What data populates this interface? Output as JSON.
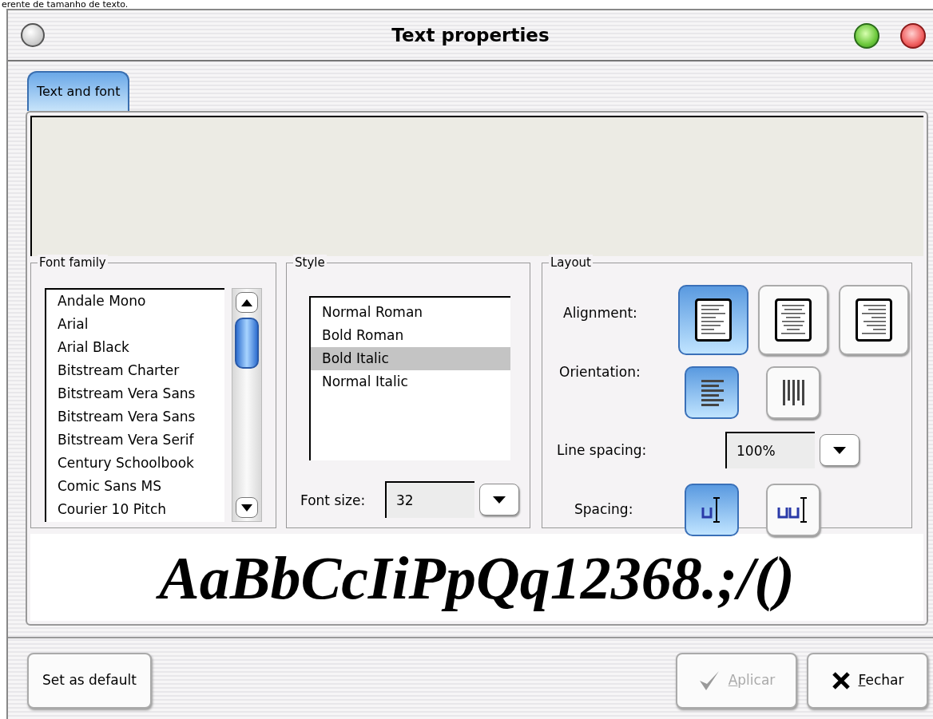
{
  "caption": "erente de tamanho de texto.",
  "window": {
    "title": "Text properties"
  },
  "tabs": [
    {
      "label": "Text and font",
      "selected": true
    }
  ],
  "font_family": {
    "label": "Font family",
    "items": [
      {
        "label": "Andale Mono",
        "selected": false
      },
      {
        "label": "Arial",
        "selected": false
      },
      {
        "label": "Arial Black",
        "selected": false
      },
      {
        "label": "Bitstream Charter",
        "selected": false
      },
      {
        "label": "Bitstream Vera Sans",
        "selected": false
      },
      {
        "label": "Bitstream Vera Sans",
        "selected": false
      },
      {
        "label": "Bitstream Vera Serif",
        "selected": false
      },
      {
        "label": "Century Schoolbook",
        "selected": false
      },
      {
        "label": "Comic Sans MS",
        "selected": false
      },
      {
        "label": "Courier 10 Pitch",
        "selected": false
      }
    ]
  },
  "style": {
    "label": "Style",
    "items": [
      {
        "label": "Normal Roman",
        "selected": false
      },
      {
        "label": "Bold Roman",
        "selected": false
      },
      {
        "label": "Bold Italic",
        "selected": true
      },
      {
        "label": "Normal Italic",
        "selected": false
      }
    ],
    "font_size": {
      "label": "Font size:",
      "value": "32"
    }
  },
  "layout": {
    "label": "Layout",
    "alignment": {
      "label": "Alignment:",
      "options": [
        {
          "kind": "left",
          "selected": true
        },
        {
          "kind": "center",
          "selected": false
        },
        {
          "kind": "right",
          "selected": false
        }
      ]
    },
    "orientation": {
      "label": "Orientation:",
      "options": [
        {
          "kind": "horizontal",
          "selected": true
        },
        {
          "kind": "vertical",
          "selected": false
        }
      ]
    },
    "line_spacing": {
      "label": "Line spacing:",
      "value": "100%"
    },
    "spacing": {
      "label": "Spacing:",
      "options": [
        {
          "kind": "narrow",
          "selected": true
        },
        {
          "kind": "wide",
          "selected": false
        }
      ]
    }
  },
  "sample": {
    "text": "AaBbCcIiPpQq12368.;/()"
  },
  "buttons": [
    {
      "label": "Set as default",
      "kind": "plain",
      "disabled": false
    },
    {
      "label": "Aplicar",
      "kind": "apply",
      "disabled": true
    },
    {
      "label": "Fechar",
      "kind": "close",
      "disabled": false
    }
  ]
}
